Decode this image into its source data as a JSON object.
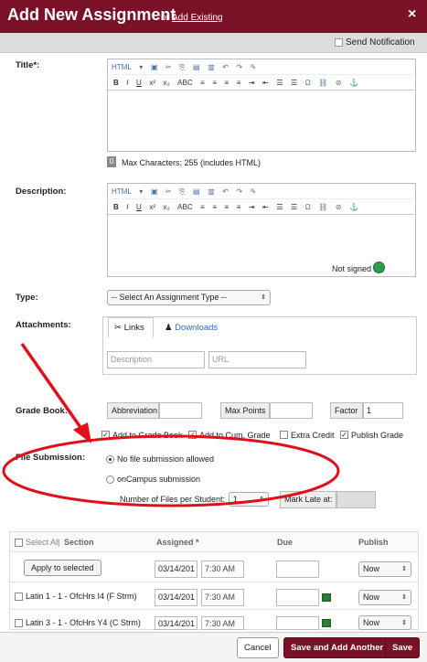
{
  "header": {
    "title": "Add New Assignment",
    "or_text": "or",
    "add_existing": "Add Existing",
    "close": "×",
    "send_notification": "Send Notification"
  },
  "title_field": {
    "label": "Title*:",
    "counter": "0",
    "hint": "Max Characters: 255 (includes HTML)"
  },
  "description_field": {
    "label": "Description:",
    "status": "Not signed in"
  },
  "toolbar": {
    "row1": [
      "HTML",
      "✂",
      "⎘",
      "📋",
      "↶",
      "↷",
      "✎"
    ],
    "row2": [
      "B",
      "I",
      "U",
      "x²",
      "x₂",
      "ABC",
      "≡",
      "≡",
      "≡",
      "≡",
      "⇥",
      "⇤",
      "☰",
      "☰",
      "Ω",
      "⚓"
    ]
  },
  "type_field": {
    "label": "Type:",
    "selected": "-- Select An Assignment Type --"
  },
  "attachments": {
    "label": "Attachments:",
    "tab_links": "Links",
    "tab_downloads": "Downloads",
    "description_placeholder": "Description",
    "url_placeholder": "URL"
  },
  "grade_book": {
    "label": "Grade Book:",
    "abbreviation": "Abbreviation",
    "max_points": "Max Points",
    "factor": "Factor",
    "factor_value": "1",
    "add_to_grade_book": "Add to Grade Book",
    "add_to_cum_grade": "Add to Cum. Grade",
    "extra_credit": "Extra Credit",
    "publish_grade": "Publish Grade"
  },
  "file_submission": {
    "label": "File Submission:",
    "option_none": "No file submission allowed",
    "option_oncampus": "onCampus submission",
    "num_files_label": "Number of Files per Student:",
    "num_files_value": "1",
    "mark_late": "Mark Late at:"
  },
  "table": {
    "select_all": "Select All",
    "section": "Section",
    "assigned": "Assigned *",
    "due": "Due",
    "publish": "Publish",
    "apply_button": "Apply to selected",
    "rows": [
      {
        "section": "",
        "date": "03/14/201",
        "time": "7:30 AM",
        "publish": "Now"
      },
      {
        "section": "Latin 1 - 1 - OfcHrs I4 (F Strm)",
        "date": "03/14/201",
        "time": "7:30 AM",
        "publish": "Now"
      },
      {
        "section": "Latin 3 - 1 - OfcHrs Y4 (C Strm)",
        "date": "03/14/201",
        "time": "7:30 AM",
        "publish": "Now"
      }
    ]
  },
  "footer": {
    "cancel": "Cancel",
    "save_and_add": "Save and Add Another",
    "save": "Save"
  },
  "colors": {
    "brand": "#7b1126",
    "annotation": "#e0101a"
  }
}
